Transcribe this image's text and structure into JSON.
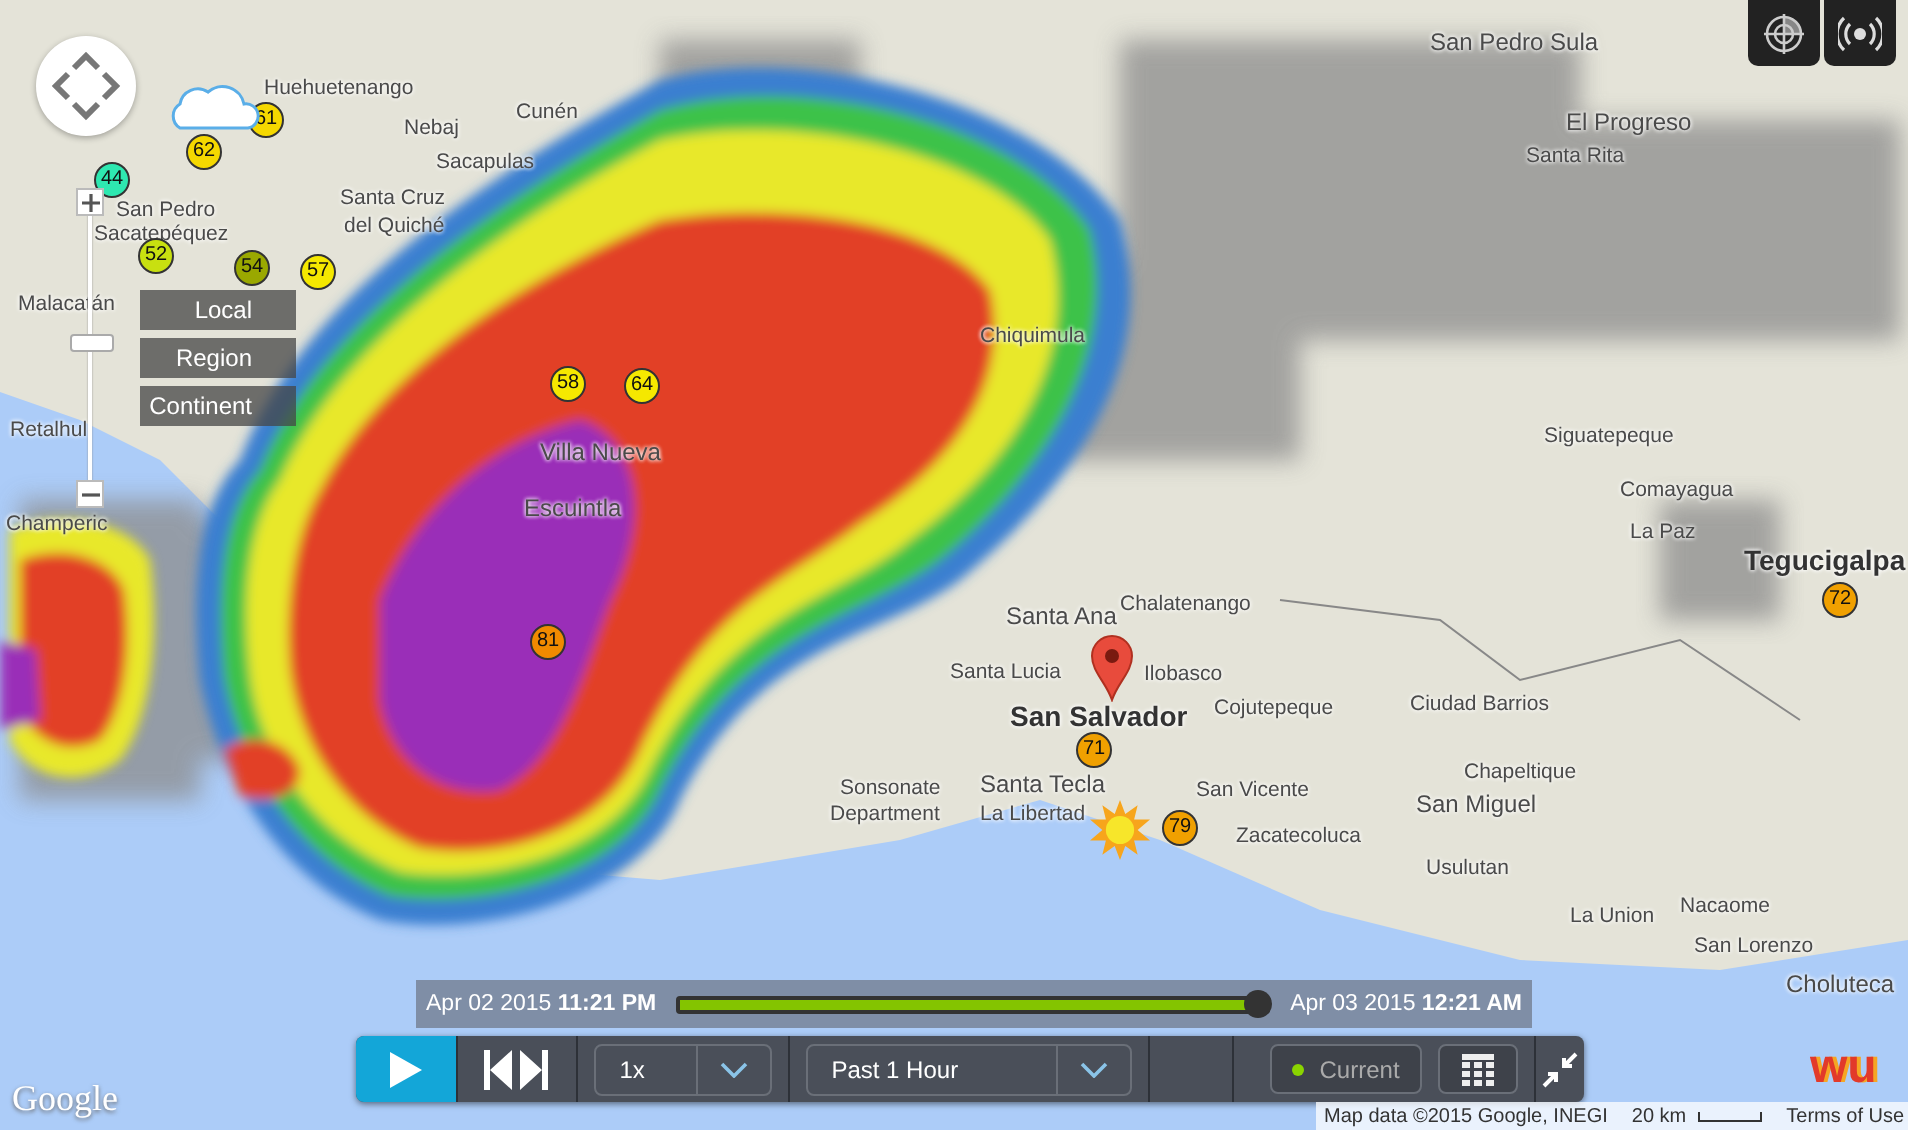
{
  "map": {
    "places": [
      {
        "name": "San Pedro Sula",
        "kind": "city"
      },
      {
        "name": "El Progreso",
        "kind": "city"
      },
      {
        "name": "Santa Rita",
        "kind": "town"
      },
      {
        "name": "Nebaj",
        "kind": "town"
      },
      {
        "name": "Cunén",
        "kind": "town"
      },
      {
        "name": "Huehuetenango",
        "kind": "town"
      },
      {
        "name": "Sacapulas",
        "kind": "town"
      },
      {
        "name": "Santa Cruz",
        "kind": "town"
      },
      {
        "name": "del Quiché",
        "kind": "town"
      },
      {
        "name": "San Pedro",
        "kind": "town"
      },
      {
        "name": "Sacatepéquez",
        "kind": "town"
      },
      {
        "name": "Malacatán",
        "kind": "town"
      },
      {
        "name": "Retalhul",
        "kind": "town"
      },
      {
        "name": "Champeric",
        "kind": "town"
      },
      {
        "name": "Villa Nueva",
        "kind": "city"
      },
      {
        "name": "Escuintla",
        "kind": "city"
      },
      {
        "name": "Chalatenango",
        "kind": "town"
      },
      {
        "name": "Santa Ana",
        "kind": "city"
      },
      {
        "name": "Santa Lucia",
        "kind": "town"
      },
      {
        "name": "Ilobasco",
        "kind": "town"
      },
      {
        "name": "San Salvador",
        "kind": "capital"
      },
      {
        "name": "Cojutepeque",
        "kind": "town"
      },
      {
        "name": "Santa Tecla",
        "kind": "city"
      },
      {
        "name": "La Libertad",
        "kind": "town"
      },
      {
        "name": "San Vicente",
        "kind": "town"
      },
      {
        "name": "Zacatecoluca",
        "kind": "town"
      },
      {
        "name": "Ciudad Barrios",
        "kind": "town"
      },
      {
        "name": "Chapeltique",
        "kind": "town"
      },
      {
        "name": "San Miguel",
        "kind": "city"
      },
      {
        "name": "Usulutan",
        "kind": "town"
      },
      {
        "name": "Siguatepeque",
        "kind": "town"
      },
      {
        "name": "Comayagua",
        "kind": "town"
      },
      {
        "name": "La Paz",
        "kind": "town"
      },
      {
        "name": "Tegucigalpa",
        "kind": "capital"
      },
      {
        "name": "Nacaome",
        "kind": "town"
      },
      {
        "name": "San Lorenzo",
        "kind": "town"
      },
      {
        "name": "Choluteca",
        "kind": "city"
      },
      {
        "name": "La Union",
        "kind": "town"
      },
      {
        "name": "Sonsonate",
        "kind": "town"
      },
      {
        "name": "Department",
        "kind": "town"
      },
      {
        "name": "Chiquimula",
        "kind": "town"
      }
    ],
    "stations": [
      {
        "temp": "61",
        "color": "#f5d800"
      },
      {
        "temp": "62",
        "color": "#f5d800"
      },
      {
        "temp": "44",
        "color": "#2ee8b0"
      },
      {
        "temp": "52",
        "color": "#c8e010"
      },
      {
        "temp": "54",
        "color": "#9aa800"
      },
      {
        "temp": "57",
        "color": "#f5e800"
      },
      {
        "temp": "58",
        "color": "#f5e800"
      },
      {
        "temp": "64",
        "color": "#f5e800"
      },
      {
        "temp": "81",
        "color": "#f08a00"
      },
      {
        "temp": "71",
        "color": "#f0a000"
      },
      {
        "temp": "79",
        "color": "#f0a000"
      },
      {
        "temp": "72",
        "color": "#f0a000"
      }
    ],
    "zoom_levels": [
      {
        "label": "Local",
        "selected": false
      },
      {
        "label": "Region",
        "selected": false
      },
      {
        "label": "Continent",
        "selected": false
      }
    ],
    "google_logo": "Google",
    "attribution": "Map data ©2015 Google, INEGI",
    "scale": "20 km",
    "terms": "Terms of Use",
    "brand_logo": "wu"
  },
  "timeline": {
    "start": "Apr 02 2015 **11:21 PM**",
    "end": "Apr 03 2015 **12:21 AM**",
    "level": 0.98
  },
  "controls": {
    "speed": "1x",
    "range": "Past 1 Hour",
    "current": {
      "label": "Current",
      "on": true
    }
  }
}
